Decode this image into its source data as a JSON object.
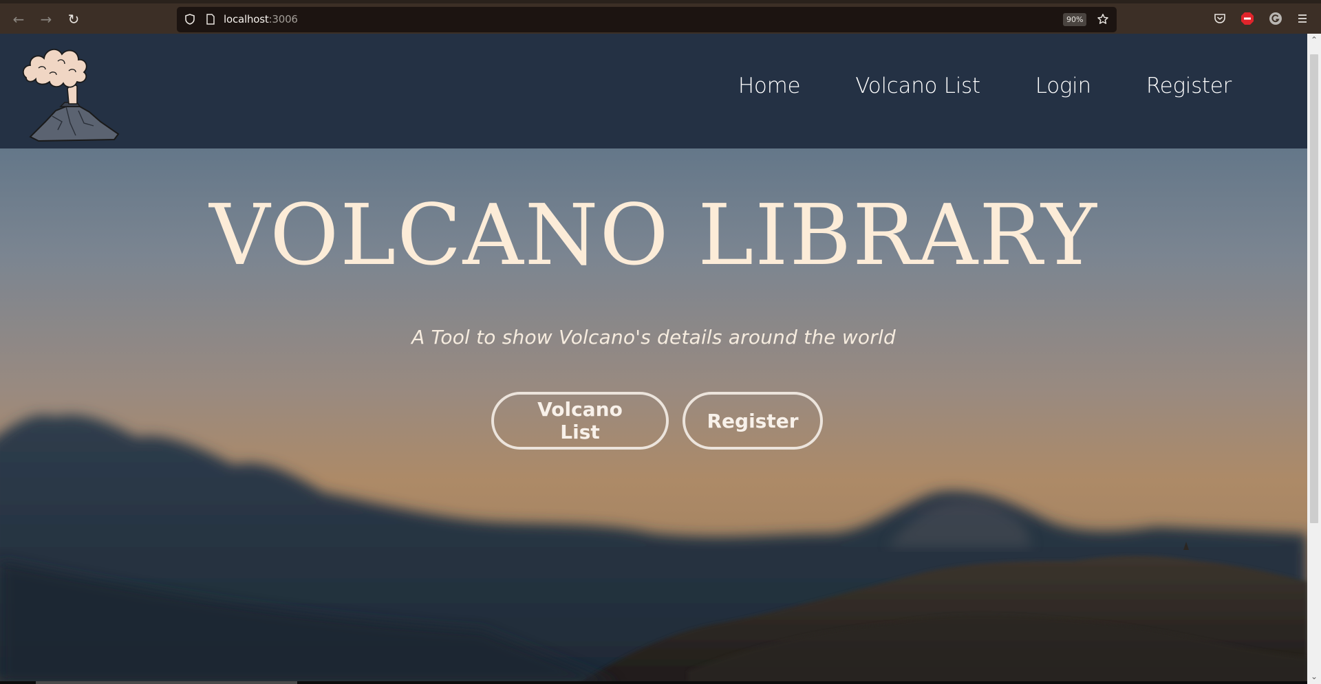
{
  "browser": {
    "url_host": "localhost",
    "url_port": ":3006",
    "zoom_level": "90%",
    "back_icon": "arrow-left-icon",
    "forward_icon": "arrow-right-icon",
    "reload_icon": "reload-icon"
  },
  "site": {
    "nav": [
      {
        "label": "Home"
      },
      {
        "label": "Volcano List"
      },
      {
        "label": "Login"
      },
      {
        "label": "Register"
      }
    ]
  },
  "hero": {
    "title": "VOLCANO LIBRARY",
    "subtitle": "A Tool to show Volcano's details around the world",
    "buttons": {
      "list_label": "Volcano List",
      "register_label": "Register"
    }
  },
  "colors": {
    "header_bg": "#243144",
    "title_color": "#fcecd8",
    "chrome_bg": "#3c2f26"
  }
}
